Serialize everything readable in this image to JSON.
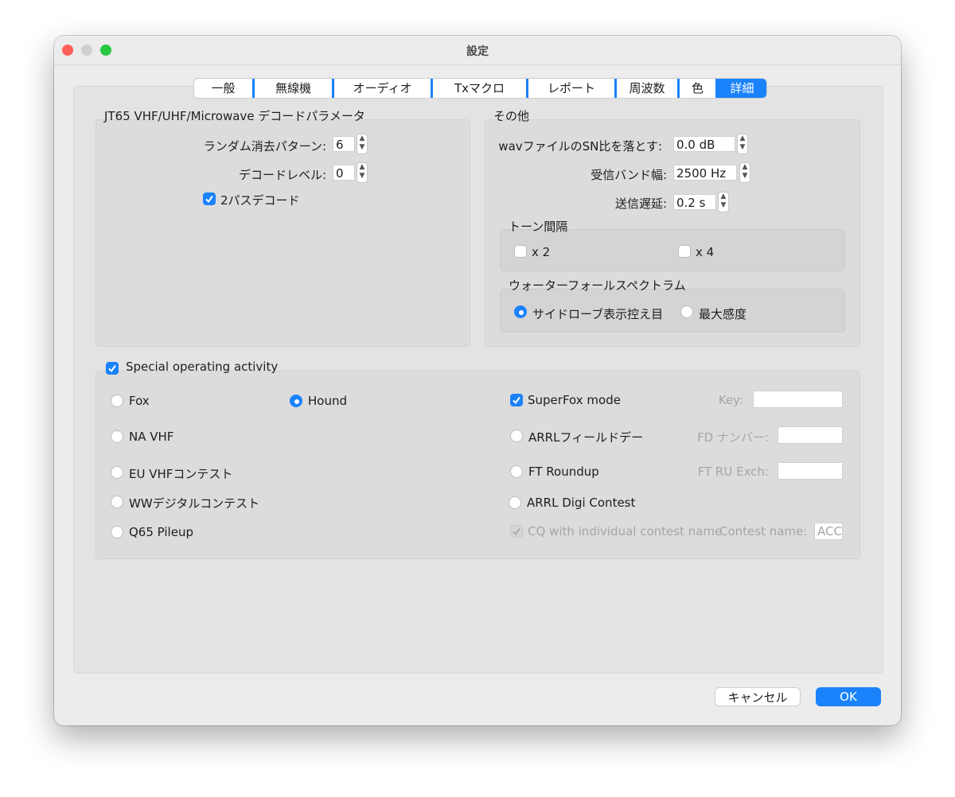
{
  "window": {
    "title": "設定"
  },
  "tabs": [
    "一般",
    "無線機",
    "オーディオ",
    "Txマクロ",
    "レポート",
    "周波数",
    "色",
    "詳細"
  ],
  "selected_tab": "詳細",
  "jt65": {
    "title": "JT65 VHF/UHF/Microwave デコードパラメータ",
    "random_erasure_label": "ランダム消去パターン:",
    "random_erasure_value": "6",
    "decode_level_label": "デコードレベル:",
    "decode_level_value": "0",
    "two_pass_label": "2パスデコード",
    "two_pass_checked": true
  },
  "misc": {
    "title": "その他",
    "degrade_label": "wavファイルのSN比を落とす:",
    "degrade_value": "0.0 dB",
    "rx_bandwidth_label": "受信バンド幅:",
    "rx_bandwidth_value": "2500  Hz",
    "tx_delay_label": "送信遅延:",
    "tx_delay_value": "0.2  s",
    "tone_spacing_title": "トーン間隔",
    "tone_x2": "x 2",
    "tone_x4": "x 4",
    "waterfall_title": "ウォーターフォールスペクトラム",
    "low_sidelobes": "サイドローブ表示控え目",
    "max_sensitivity": "最大感度"
  },
  "special": {
    "title": "Special operating activity",
    "enabled": true,
    "fox": "Fox",
    "hound": "Hound",
    "selected": "Hound",
    "na_vhf": "NA VHF",
    "eu_vhf": "EU VHFコンテスト",
    "ww_digi": "WWデジタルコンテスト",
    "q65": "Q65 Pileup",
    "superfox": "SuperFox mode",
    "superfox_checked": true,
    "key_label": "Key:",
    "arrl_field_day": "ARRLフィールドデー",
    "fd_number_label": "FD ナンバー:",
    "ft_roundup": "FT Roundup",
    "ft_ru_exch_label": "FT RU Exch:",
    "arrl_digi": "ARRL Digi Contest",
    "cq_individual": "CQ with individual contest name",
    "contest_name_label": "Contest name:",
    "contest_name_value": "ACC"
  },
  "buttons": {
    "cancel": "キャンセル",
    "ok": "OK"
  },
  "colors": {
    "accent": "#1a82fb",
    "close": "#ff5f57",
    "minimize": "#d0d0d0",
    "zoom": "#28c840"
  }
}
